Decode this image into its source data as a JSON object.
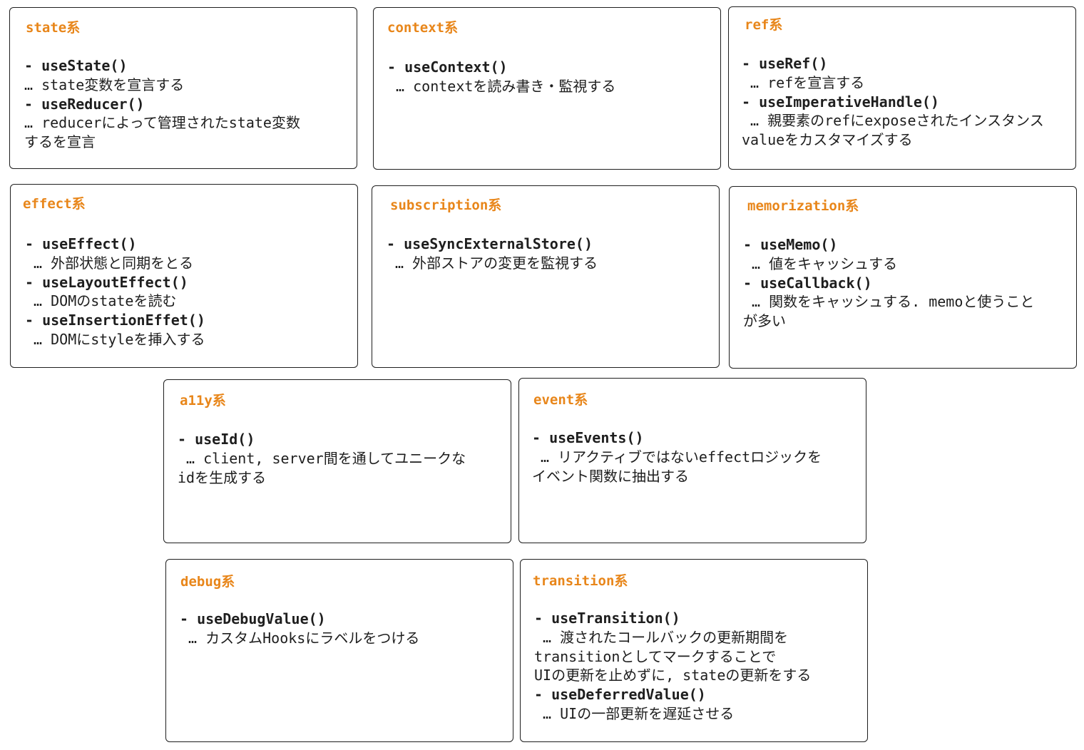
{
  "accent_color": "#e8861a",
  "cards": [
    {
      "title": "state系",
      "lines": [
        {
          "text": "- useState()",
          "kind": "hook"
        },
        {
          "text": "… state変数を宣言する",
          "kind": "desc"
        },
        {
          "text": "- useReducer()",
          "kind": "hook"
        },
        {
          "text": "… reducerによって管理されたstate変数",
          "kind": "desc"
        },
        {
          "text": "するを宣言",
          "kind": "desc"
        }
      ]
    },
    {
      "title": "context系",
      "lines": [
        {
          "text": "- useContext()",
          "kind": "hook"
        },
        {
          "text": " … contextを読み書き・監視する",
          "kind": "desc"
        }
      ]
    },
    {
      "title": "ref系",
      "lines": [
        {
          "text": "- useRef()",
          "kind": "hook"
        },
        {
          "text": " … refを宣言する",
          "kind": "desc"
        },
        {
          "text": "- useImperativeHandle()",
          "kind": "hook"
        },
        {
          "text": " … 親要素のrefにexposeされたインスタンス",
          "kind": "desc"
        },
        {
          "text": "valueをカスタマイズする",
          "kind": "desc"
        }
      ]
    },
    {
      "title": "effect系",
      "lines": [
        {
          "text": "- useEffect()",
          "kind": "hook"
        },
        {
          "text": " … 外部状態と同期をとる",
          "kind": "desc"
        },
        {
          "text": "- useLayoutEffect()",
          "kind": "hook"
        },
        {
          "text": " … DOMのstateを読む",
          "kind": "desc"
        },
        {
          "text": "- useInsertionEffet()",
          "kind": "hook"
        },
        {
          "text": " … DOMにstyleを挿入する",
          "kind": "desc"
        }
      ]
    },
    {
      "title": "subscription系",
      "lines": [
        {
          "text": "- useSyncExternalStore()",
          "kind": "hook"
        },
        {
          "text": " … 外部ストアの変更を監視する",
          "kind": "desc"
        }
      ]
    },
    {
      "title": "memorization系",
      "lines": [
        {
          "text": "- useMemo()",
          "kind": "hook"
        },
        {
          "text": " … 値をキャッシュする",
          "kind": "desc"
        },
        {
          "text": "- useCallback()",
          "kind": "hook"
        },
        {
          "text": " … 関数をキャッシュする. memoと使うこと",
          "kind": "desc"
        },
        {
          "text": "が多い",
          "kind": "desc"
        }
      ]
    },
    {
      "title": "a11y系",
      "lines": [
        {
          "text": "- useId()",
          "kind": "hook"
        },
        {
          "text": " … client, server間を通してユニークな",
          "kind": "desc"
        },
        {
          "text": "idを生成する",
          "kind": "desc"
        }
      ]
    },
    {
      "title": "event系",
      "lines": [
        {
          "text": "- useEvents()",
          "kind": "hook"
        },
        {
          "text": " … リアクティブではないeffectロジックを",
          "kind": "desc"
        },
        {
          "text": "イベント関数に抽出する",
          "kind": "desc"
        }
      ]
    },
    {
      "title": "debug系",
      "lines": [
        {
          "text": "- useDebugValue()",
          "kind": "hook"
        },
        {
          "text": " … カスタムHooksにラベルをつける",
          "kind": "desc"
        }
      ]
    },
    {
      "title": "transition系",
      "lines": [
        {
          "text": "- useTransition()",
          "kind": "hook"
        },
        {
          "text": " … 渡されたコールバックの更新期間を",
          "kind": "desc"
        },
        {
          "text": "transitionとしてマークすることで",
          "kind": "desc"
        },
        {
          "text": "UIの更新を止めずに, stateの更新をする",
          "kind": "desc"
        },
        {
          "text": "- useDeferredValue()",
          "kind": "hook"
        },
        {
          "text": " … UIの一部更新を遅延させる",
          "kind": "desc"
        }
      ]
    }
  ]
}
